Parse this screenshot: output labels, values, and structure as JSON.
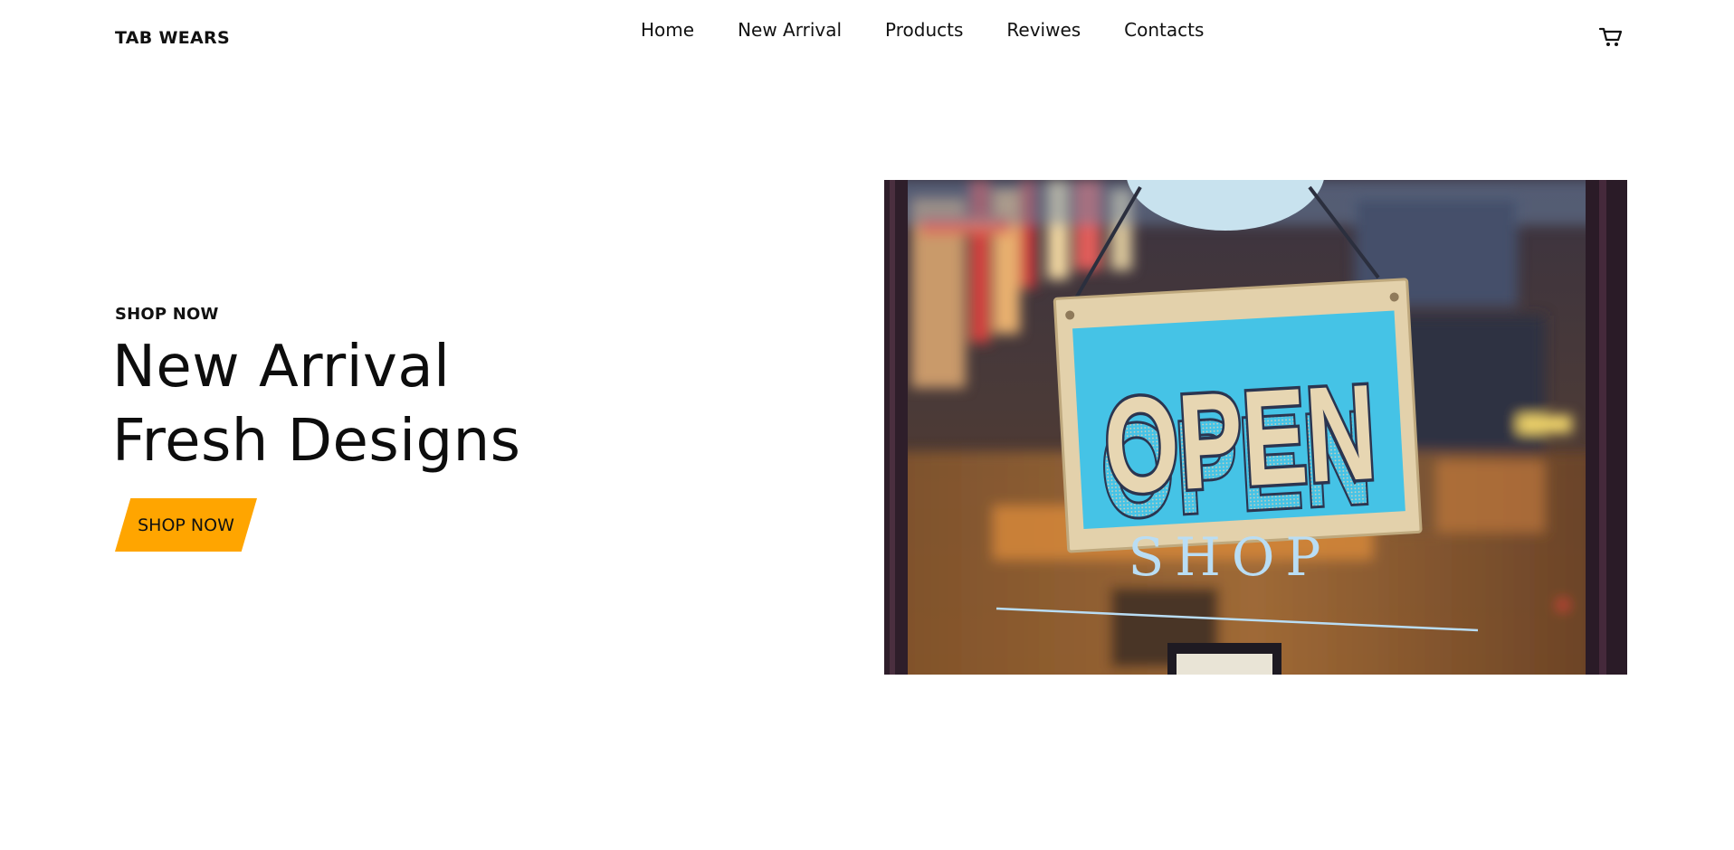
{
  "brand": {
    "name": "TAB WEARS"
  },
  "nav": {
    "items": [
      {
        "label": "Home"
      },
      {
        "label": "New Arrival"
      },
      {
        "label": "Products"
      },
      {
        "label": "Reviwes"
      },
      {
        "label": "Contacts"
      }
    ]
  },
  "cart": {
    "icon": "cart-icon"
  },
  "hero": {
    "eyebrow": "SHOP NOW",
    "title_line_1": "New Arrival",
    "title_line_2": "Fresh Designs",
    "button_label": "SHOP NOW",
    "image": {
      "sign_text": "OPEN",
      "door_text": "SHOP"
    }
  },
  "colors": {
    "accent": "#FFA500",
    "text": "#111111",
    "background": "#ffffff",
    "sign_blue": "#45C3E6",
    "sign_navy": "#2B3550",
    "sign_cream": "#E7D6B2",
    "door_text": "#B9DDF4"
  }
}
